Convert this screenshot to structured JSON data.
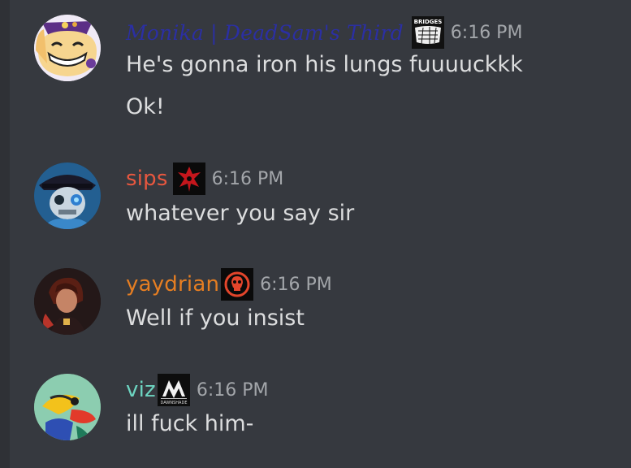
{
  "colors": {
    "background": "#36393f",
    "text": "#dcddde",
    "timestamp": "#a3a6aa"
  },
  "messages": [
    {
      "username": "Monika | DeadSam's Third",
      "username_color": "#2b2fa3",
      "badge_icon": "bridges-map-badge-icon",
      "badge_text": "BRIDGES",
      "timestamp": "6:16 PM",
      "lines": [
        "He's gonna iron his lungs fuuuuckkk",
        "Ok!"
      ]
    },
    {
      "username": "sips",
      "username_color": "#e8573f",
      "badge_icon": "red-emblem-badge-icon",
      "timestamp": "6:16 PM",
      "lines": [
        "whatever you say sir"
      ]
    },
    {
      "username": "yaydrian",
      "username_color": "#e67e22",
      "badge_icon": "orange-skull-badge-icon",
      "timestamp": "6:16 PM",
      "lines": [
        "Well if you insist"
      ]
    },
    {
      "username": "viz",
      "username_color": "#6dd5c1",
      "badge_icon": "dawnshade-logo-badge-icon",
      "badge_text": "DAWNSHADE",
      "timestamp": "6:16 PM",
      "lines": [
        "ill fuck him-"
      ]
    }
  ]
}
